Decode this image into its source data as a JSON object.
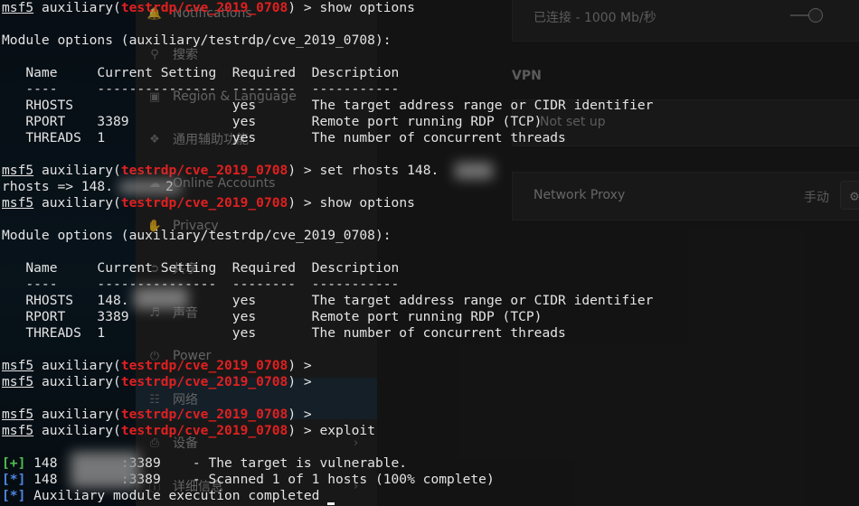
{
  "background_window": {
    "sidebar": {
      "items": [
        {
          "label": "Notifications",
          "icon": "bell-icon"
        },
        {
          "label": "搜索",
          "icon": "search-icon"
        },
        {
          "label": "Region & Language",
          "icon": "camera-icon"
        },
        {
          "label": "通用辅助功能",
          "icon": "accessibility-icon"
        },
        {
          "label": "Online Accounts",
          "icon": "cloud-icon"
        },
        {
          "label": "Privacy",
          "icon": "hand-icon"
        },
        {
          "label": "共享",
          "icon": "share-icon"
        },
        {
          "label": "声音",
          "icon": "speaker-icon"
        },
        {
          "label": "Power",
          "icon": "power-icon"
        },
        {
          "label": "网络",
          "icon": "network-icon"
        },
        {
          "label": "设备",
          "icon": "printer-icon"
        },
        {
          "label": "详细信息",
          "icon": "info-icon"
        }
      ]
    },
    "wired_status": "已连接 - 1000 Mb/秒",
    "vpn_title": "VPN",
    "vpn_setup": "Not set up",
    "proxy_label": "Network Proxy",
    "proxy_status": "手动"
  },
  "terminal": {
    "prompt_prefix": "msf5",
    "prompt_mid": " auxiliary(",
    "module_path": "testrdp/cve_2019_0708",
    "prompt_suffix": ") >",
    "cmd_show_options": " show options",
    "cmd_set_rhosts": " set rhosts 148.",
    "cmd_exploit": " exploit",
    "module_options_header": "Module options (auxiliary/testrdp/cve_2019_0708):",
    "columns_header": "   Name     Current Setting  Required  Description",
    "columns_rule": "   ----     ---------------  --------  -----------",
    "rows_first": [
      "   RHOSTS                    yes       The target address range or CIDR identifier",
      "   RPORT    3389             yes       Remote port running RDP (TCP)",
      "   THREADS  1                yes       The number of concurrent threads"
    ],
    "rows_second": [
      "   RHOSTS   148.             yes       The target address range or CIDR identifier",
      "   RPORT    3389             yes       Remote port running RDP (TCP)",
      "   THREADS  1                yes       The number of concurrent threads"
    ],
    "rhosts_result_a": "rhosts => 148.",
    "rhosts_result_b": "2",
    "result_plus_tag": "[+]",
    "result_plus_text": " 148        :3389    - The target is vulnerable.",
    "result_star_tag": "[*]",
    "result_star_text": " 148        :3389    - Scanned 1 of 1 hosts (100% complete)",
    "result_star2_text": " Auxiliary module execution completed"
  }
}
